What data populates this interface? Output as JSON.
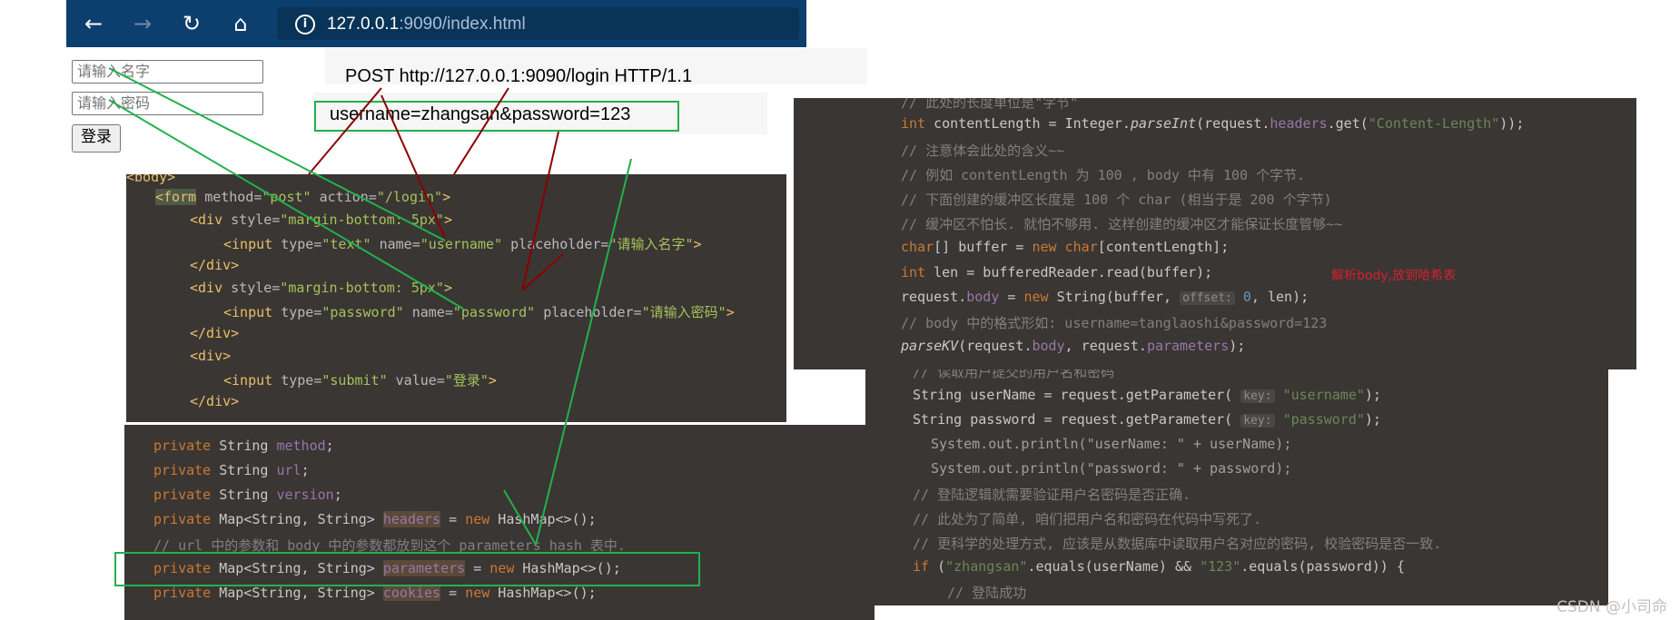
{
  "browser": {
    "url_host": "127.0.0.1",
    "url_rest": ":9090/index.html"
  },
  "form": {
    "name_placeholder": "请输入名字",
    "password_placeholder": "请输入密码",
    "submit_label": "登录"
  },
  "http": {
    "request_line": "POST http://127.0.0.1:9090/login HTTP/1.1",
    "body_line": "username=zhangsan&password=123"
  },
  "html_code": {
    "lines": [
      "<body>",
      "    <form method=\"post\" action=\"/login\">",
      "        <div style=\"margin-bottom: 5px\">",
      "            <input type=\"text\" name=\"username\" placeholder=\"请输入名字\">",
      "        </div>",
      "        <div style=\"margin-bottom: 5px\">",
      "            <input type=\"password\" name=\"password\" placeholder=\"请输入密码\">",
      "        </div>",
      "        <div>",
      "            <input type=\"submit\" value=\"登录\">",
      "        </div>"
    ]
  },
  "java_fields": {
    "lines": [
      "    private String method;",
      "    private String url;",
      "    private String version;",
      "    private Map<String, String> headers = new HashMap<>();",
      "    // url 中的参数和 body 中的参数都放到这个 parameters hash 表中.",
      "    private Map<String, String> parameters = new HashMap<>();",
      "    private Map<String, String> cookies = new HashMap<>();"
    ]
  },
  "java_parse": {
    "lines": [
      "// 此处的长度单位是\"字节\"",
      "int contentLength = Integer.parseInt(request.headers.get(\"Content-Length\"));",
      "// 注意体会此处的含义~~",
      "// 例如 contentLength 为 100 , body 中有 100 个字节.",
      "// 下面创建的缓冲区长度是 100 个 char (相当于是 200 个字节)",
      "// 缓冲区不怕长. 就怕不够用. 这样创建的缓冲区才能保证长度管够~~",
      "char[] buffer = new char[contentLength];",
      "int len = bufferedReader.read(buffer);",
      "request.body = new String(buffer, offset: 0, len);",
      "// body 中的格式形如: username=tanglaoshi&password=123",
      "parseKV(request.body, request.parameters);"
    ],
    "note": "解析body,放到哈希表"
  },
  "java_login": {
    "lines": [
      "// 读取用户提交的用户名和密码",
      "String userName = request.getParameter( key: \"username\");",
      "String password = request.getParameter( key: \"password\");",
      "System.out.println(\"userName: \" + userName);",
      "System.out.println(\"password: \" + password);",
      "// 登陆逻辑就需要验证用户名密码是否正确.",
      "// 此处为了简单, 咱们把用户名和密码在代码中写死了.",
      "// 更科学的处理方式, 应该是从数据库中读取用户名对应的密码, 校验密码是否一致.",
      "if (\"zhangsan\".equals(userName) && \"123\".equals(password)) {",
      "    // 登陆成功"
    ]
  },
  "watermark": "CSDN @小司命",
  "colors": {
    "browser_bar": "#0d3f6e",
    "code_bg": "#3a3633",
    "annotation_green": "#22b14c",
    "annotation_darkred": "#8b0000",
    "note_red": "#d4212e"
  }
}
